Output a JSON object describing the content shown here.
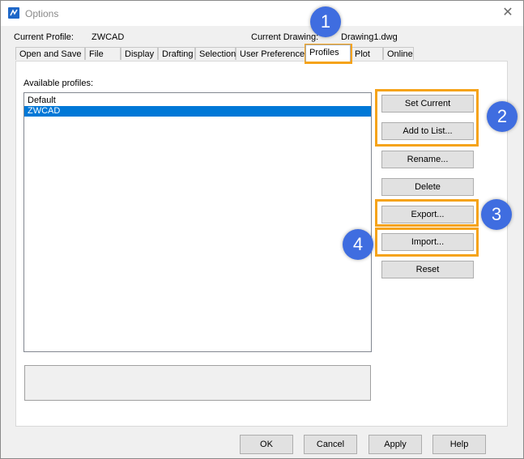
{
  "window": {
    "title": "Options"
  },
  "profile": {
    "current_profile_label": "Current Profile:",
    "current_profile_value": "ZWCAD"
  },
  "drawing": {
    "current_drawing_label": "Current Drawing:",
    "current_drawing_value": "Drawing1.dwg"
  },
  "tabs": [
    {
      "label": "Open and Save"
    },
    {
      "label": "File"
    },
    {
      "label": "Display"
    },
    {
      "label": "Drafting"
    },
    {
      "label": "Selection"
    },
    {
      "label": "User Preferences"
    },
    {
      "label": "Profiles",
      "active": true
    },
    {
      "label": "Plot"
    },
    {
      "label": "Online"
    }
  ],
  "profiles": {
    "available_label": "Available profiles:",
    "items": [
      {
        "name": "Default",
        "selected": false
      },
      {
        "name": "ZWCAD",
        "selected": true
      }
    ]
  },
  "actions": {
    "set_current": "Set Current",
    "add_to_list": "Add to List...",
    "rename": "Rename...",
    "delete": "Delete",
    "export": "Export...",
    "import": "Import...",
    "reset": "Reset"
  },
  "footer": {
    "ok": "OK",
    "cancel": "Cancel",
    "apply": "Apply",
    "help": "Help"
  },
  "annotations": {
    "badge_1": "1",
    "badge_2": "2",
    "badge_3": "3",
    "badge_4": "4"
  },
  "colors": {
    "highlight": "#f5a31a",
    "badge": "#3f6de0",
    "selection": "#0078d7"
  }
}
